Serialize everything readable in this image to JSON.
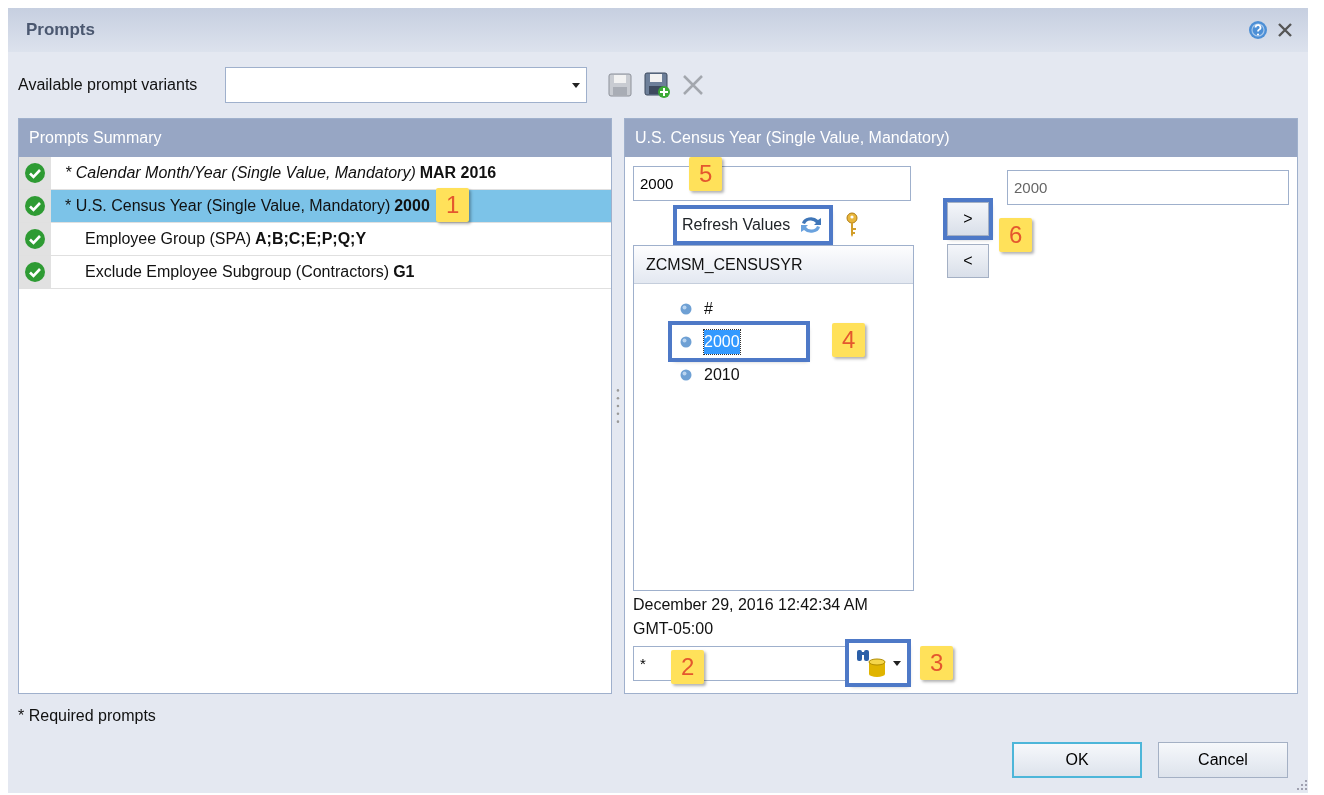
{
  "window": {
    "title": "Prompts"
  },
  "variants": {
    "label": "Available prompt variants"
  },
  "summary": {
    "title": "Prompts Summary",
    "items": [
      {
        "label": "* Calendar Month/Year (Single Value, Mandatory)",
        "value": "MAR 2016",
        "italic": true,
        "required": true,
        "selected": false,
        "complete": true
      },
      {
        "label": "* U.S. Census Year (Single Value, Mandatory)",
        "value": "2000",
        "italic": false,
        "required": true,
        "selected": true,
        "complete": true,
        "callout": "1"
      },
      {
        "label": "Employee Group (SPA)",
        "value": "A;B;C;E;P;Q;Y",
        "italic": false,
        "required": false,
        "selected": false,
        "complete": true
      },
      {
        "label": "Exclude Employee Subgroup (Contractors)",
        "value": "G1",
        "italic": false,
        "required": false,
        "selected": false,
        "complete": true
      }
    ]
  },
  "detail": {
    "title": "U.S. Census Year (Single Value, Mandatory)",
    "value_input": {
      "value": "2000",
      "callout": "5"
    },
    "refresh": {
      "label": "Refresh Values",
      "highlighted": true
    },
    "list": {
      "header": "ZCMSM_CENSUSYR",
      "items": [
        {
          "label": "#",
          "selected": false,
          "highlighted": false
        },
        {
          "label": "2000",
          "selected": true,
          "highlighted": true,
          "callout": "4"
        },
        {
          "label": "2010",
          "selected": false,
          "highlighted": false
        }
      ]
    },
    "timestamp": "December 29, 2016 12:42:34 AM GMT-05:00",
    "search_input": {
      "value": "*",
      "callout": "2"
    },
    "search_button": {
      "highlighted": true,
      "callout": "3"
    },
    "add_button": {
      "label": ">",
      "highlighted": true,
      "callout": "6"
    },
    "remove_button": {
      "label": "<",
      "highlighted": false
    },
    "selected_value": {
      "value": "2000"
    }
  },
  "footer": {
    "note": "* Required prompts",
    "buttons": [
      {
        "label": "OK",
        "kind": "primary"
      },
      {
        "label": "Cancel",
        "kind": "secondary"
      }
    ]
  }
}
